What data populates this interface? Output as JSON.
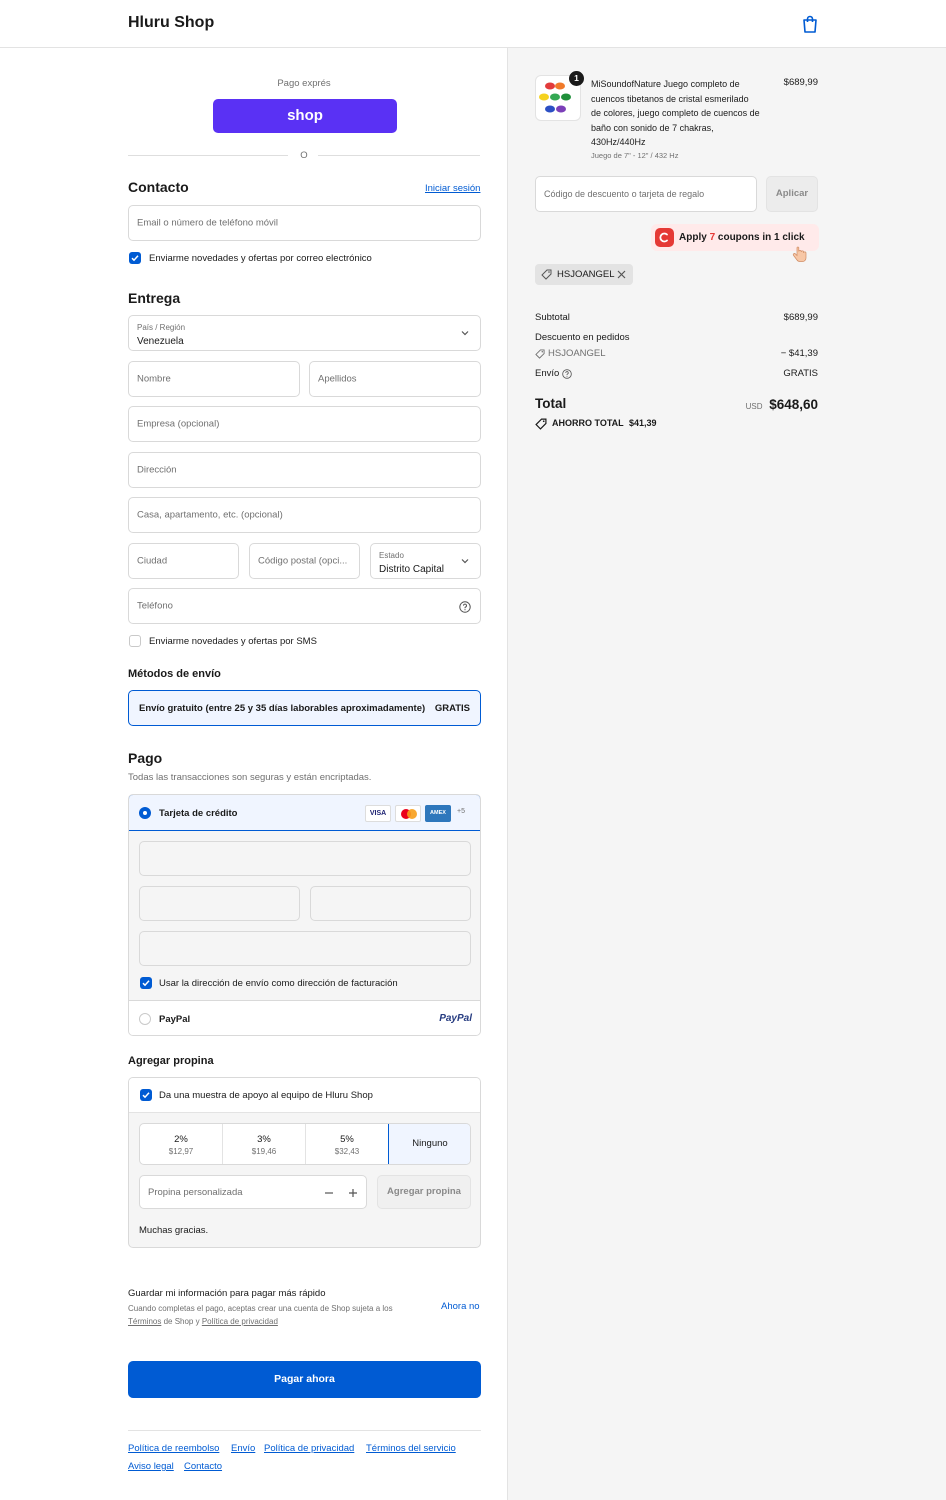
{
  "header": {
    "shop_name": "Hluru Shop",
    "cart_icon": "shopping-bag-icon"
  },
  "express": {
    "label": "Pago exprés",
    "shop_button": "shop",
    "divider": "O"
  },
  "contact": {
    "title": "Contacto",
    "login_link": "Iniciar sesión",
    "email_placeholder": "Email o número de teléfono móvil",
    "news_checkbox": "Enviarme novedades y ofertas por correo electrónico"
  },
  "delivery": {
    "title": "Entrega",
    "country_label": "País / Región",
    "country_value": "Venezuela",
    "first_name": "Nombre",
    "last_name": "Apellidos",
    "company": "Empresa (opcional)",
    "address": "Dirección",
    "apartment": "Casa, apartamento, etc. (opcional)",
    "city": "Ciudad",
    "postal": "Código postal (opci...",
    "state_label": "Estado",
    "state_value": "Distrito Capital",
    "phone": "Teléfono",
    "sms_checkbox": "Enviarme novedades y ofertas por SMS"
  },
  "shipping": {
    "title": "Métodos de envío",
    "option": "Envío gratuito (entre 25 y 35 días laborables aproximadamente)",
    "price": "GRATIS"
  },
  "payment": {
    "title": "Pago",
    "subtitle": "Todas las transacciones son seguras y están encriptadas.",
    "credit_card": "Tarjeta de crédito",
    "card_brands": [
      "VISA",
      "AMEX",
      "+5"
    ],
    "billing_checkbox": "Usar la dirección de envío como dirección de facturación",
    "paypal": "PayPal",
    "paypal_logo": "PayPal"
  },
  "tip": {
    "title": "Agregar propina",
    "checkbox": "Da una muestra de apoyo al equipo de Hluru Shop",
    "options": [
      {
        "pct": "2%",
        "amount": "$12,97"
      },
      {
        "pct": "3%",
        "amount": "$19,46"
      },
      {
        "pct": "5%",
        "amount": "$32,43"
      }
    ],
    "none": "Ninguno",
    "custom_placeholder": "Propina personalizada",
    "add_button": "Agregar propina",
    "thanks": "Muchas gracias."
  },
  "save_info": {
    "title": "Guardar mi información para pagar más rápido",
    "desc": "Cuando completas el pago, aceptas crear una cuenta de Shop sujeta a los",
    "terms": "Términos",
    "desc2": "de Shop y",
    "privacy": "Política de privacidad",
    "not_now": "Ahora no"
  },
  "pay_button": "Pagar ahora",
  "footer": {
    "links": [
      "Política de reembolso",
      "Envío",
      "Política de privacidad",
      "Términos del servicio",
      "Aviso legal",
      "Contacto"
    ]
  },
  "order": {
    "quantity_badge": "1",
    "product_title_lines": [
      "MiSoundofNature Juego completo de",
      "cuencos tibetanos de cristal esmerilado",
      "de colores, juego completo de cuencos de",
      "baño con sonido de 7 chakras,",
      "430Hz/440Hz"
    ],
    "variant": "Juego de 7\" - 12\" / 432 Hz",
    "price": "$689,99",
    "discount_placeholder": "Código de descuento o tarjeta de regalo",
    "apply_button": "Aplicar",
    "coupon_banner": {
      "pre": "Apply",
      "count": "7",
      "post": "coupons in 1 click"
    },
    "applied_code": "HSJOANGEL",
    "subtotal_label": "Subtotal",
    "subtotal_value": "$689,99",
    "discount_label": "Descuento en pedidos",
    "discount_code": "HSJOANGEL",
    "discount_value": "− $41,39",
    "shipping_label": "Envío",
    "shipping_value": "GRATIS",
    "total_label": "Total",
    "currency": "USD",
    "total_value": "$648,60",
    "savings_label": "AHORRO TOTAL",
    "savings_value": "$41,39"
  },
  "colors": {
    "accent": "#005bd3",
    "shop_purple": "#5a31f4",
    "coupon_red": "#e53935"
  }
}
